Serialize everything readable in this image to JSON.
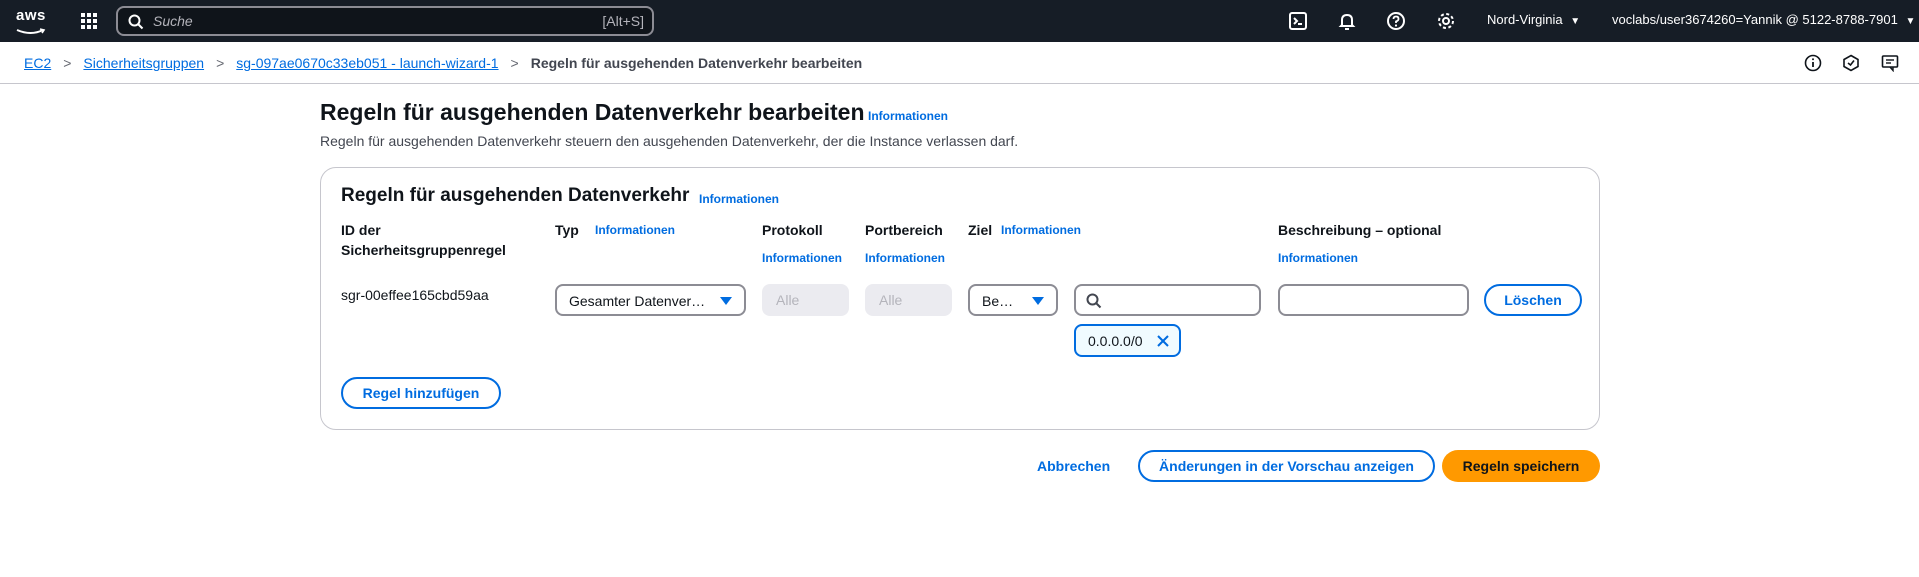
{
  "topnav": {
    "logo_text": "aws",
    "search_placeholder": "Suche",
    "search_shortcut": "[Alt+S]",
    "region": "Nord-Virginia",
    "account": "voclabs/user3674260=Yannik @ 5122-8788-7901"
  },
  "breadcrumb": {
    "items": [
      "EC2",
      "Sicherheitsgruppen",
      "sg-097ae0670c33eb051 - launch-wizard-1"
    ],
    "current": "Regeln für ausgehenden Datenverkehr bearbeiten"
  },
  "page": {
    "title": "Regeln für ausgehenden Datenverkehr bearbeiten",
    "info": "Informationen",
    "description": "Regeln für ausgehenden Datenverkehr steuern den ausgehenden Datenverkehr, der die Instance verlassen darf."
  },
  "panel": {
    "title": "Regeln für ausgehenden Datenverkehr",
    "info": "Informationen",
    "columns": {
      "rule_id_line1": "ID der",
      "rule_id_line2": "Sicherheitsgruppenregel",
      "type": "Typ",
      "type_info": "Informationen",
      "protocol": "Protokoll",
      "protocol_info": "Informationen",
      "port_range": "Portbereich",
      "port_range_info": "Informationen",
      "destination": "Ziel",
      "destination_info": "Informationen",
      "description": "Beschreibung – optional",
      "description_info": "Informationen"
    },
    "row": {
      "rule_id": "sgr-00effee165cbd59aa",
      "type_value": "Gesamter Datenver…",
      "protocol_value": "Alle",
      "port_value": "Alle",
      "destination_select": "Be…",
      "destination_search": "",
      "description_value": "",
      "delete": "Löschen",
      "token": "0.0.0.0/0"
    },
    "add_rule": "Regel hinzufügen"
  },
  "footer": {
    "cancel": "Abbrechen",
    "preview": "Änderungen in der Vorschau anzeigen",
    "save": "Regeln speichern"
  }
}
